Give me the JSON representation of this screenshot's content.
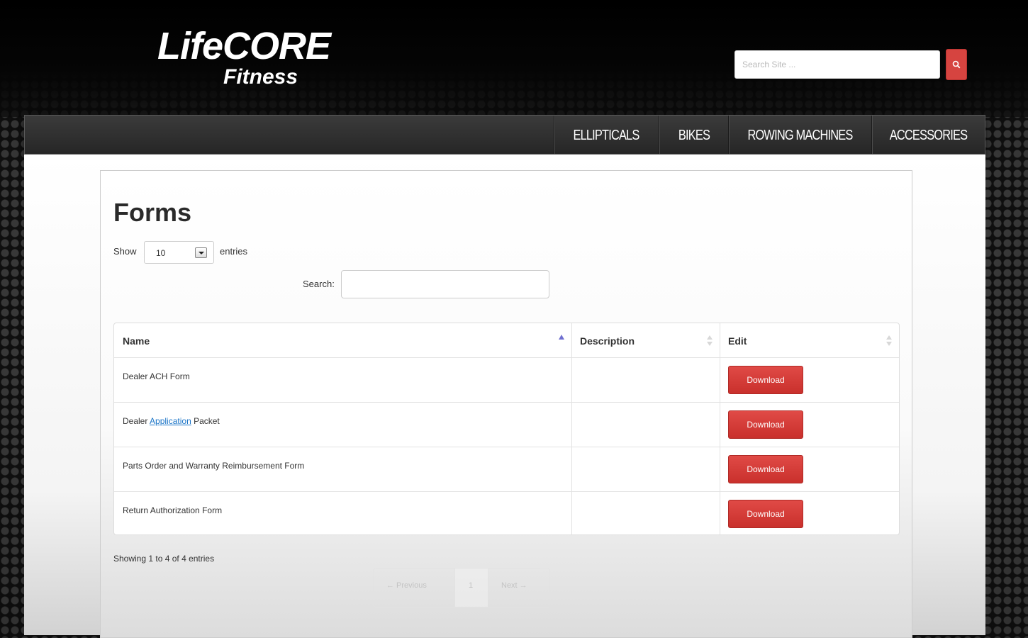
{
  "brand": {
    "logo_text_main": "LifeCORE",
    "logo_text_sub": "Fitness"
  },
  "header": {
    "search_placeholder": "Search Site ..."
  },
  "nav": {
    "items": [
      "ELLIPTICALS",
      "BIKES",
      "ROWING MACHINES",
      "ACCESSORIES"
    ]
  },
  "page": {
    "title": "Forms"
  },
  "table_controls": {
    "show_label": "Show",
    "entries_value": "10",
    "entries_label": "entries",
    "search_label": "Search:"
  },
  "table": {
    "columns": [
      "Name",
      "Description",
      "Edit"
    ],
    "rows": [
      {
        "name": "Dealer ACH Form",
        "description": "",
        "button": "Download"
      },
      {
        "name_prefix": "Dealer ",
        "name_link": "Application",
        "name_suffix": " Packet",
        "description": "",
        "button": "Download"
      },
      {
        "name": "Parts Order and Warranty Reimbursement Form",
        "description": "",
        "button": "Download"
      },
      {
        "name": "Return Authorization Form",
        "description": "",
        "button": "Download"
      }
    ]
  },
  "footer": {
    "info": "Showing 1 to 4 of 4 entries",
    "pagination": {
      "previous": "← Previous",
      "current": "1",
      "next": "Next →"
    }
  },
  "colors": {
    "accent": "#d64440",
    "link": "#1a74c7",
    "nav_bg": "#2f2f2f"
  }
}
